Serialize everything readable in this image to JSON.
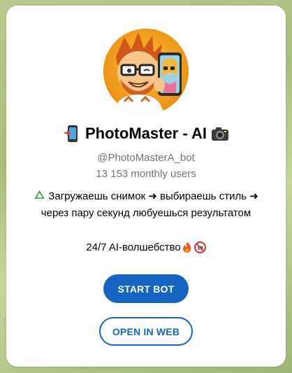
{
  "bot": {
    "name": "PhotoMaster - AI",
    "username": "@PhotoMasterA_bot",
    "monthly_users": "13 153 monthly users",
    "description_line1": "Загружаешь снимок ➜ выбираешь стиль ➜",
    "description_line2": "через пару секунд любуешься результатом",
    "tagline": "24/7 AI-волшебство"
  },
  "buttons": {
    "start_label": "START BOT",
    "web_label": "OPEN IN WEB"
  },
  "icons": {
    "title_left": "phone-emoji-icon",
    "title_right": "camera-emoji-icon",
    "desc_prefix": "recycle-emoji-icon",
    "tagline_suffix_1": "fire-emoji-icon",
    "tagline_suffix_2": "eighteen-plus-emoji-icon"
  },
  "colors": {
    "accent": "#1565c0",
    "muted_text": "#707579",
    "card_bg": "#ffffff"
  }
}
